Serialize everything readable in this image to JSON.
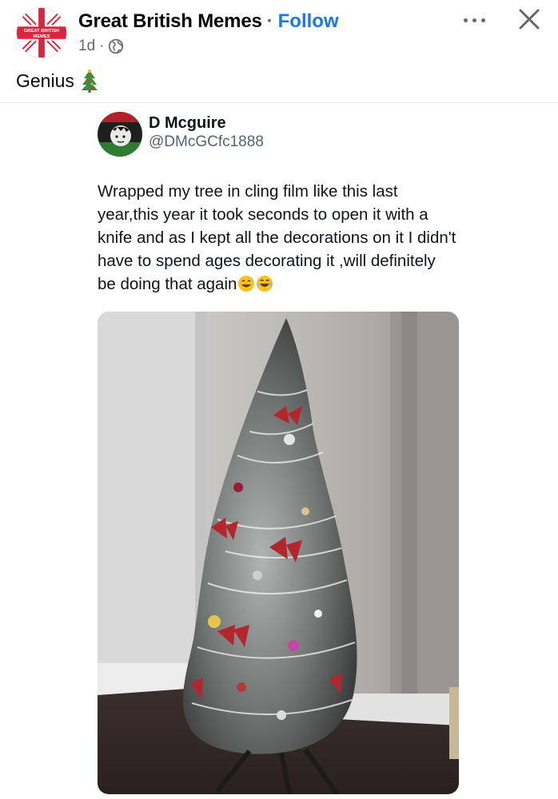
{
  "post": {
    "page_name": "Great British Memes",
    "separator": "·",
    "follow_label": "Follow",
    "time_ago": "1d",
    "meta_separator": "·",
    "caption": "Genius",
    "avatar_text_line1": "GREAT BRITISH",
    "avatar_text_line2": "MEMES"
  },
  "icons": {
    "page_avatar": "union-jack-logo",
    "privacy": "globe-icon",
    "more": "more-horizontal-icon",
    "close": "close-icon",
    "caption_emoji": "christmas-tree-emoji"
  },
  "tweet": {
    "display_name": "D Mcguire",
    "handle": "@DMcGCfc1888",
    "text": "Wrapped my tree in cling film like this last year,this year it took seconds to open it with a knife and as I kept all the decorations on it I didn't have to spend ages decorating it ,will definitely be doing that again",
    "emojis": [
      "grinning-sweat-emoji",
      "tears-of-joy-emoji"
    ],
    "photo": "christmas-tree-wrapped-in-cling-film"
  },
  "colors": {
    "follow_blue": "#1877f2",
    "secondary_text": "#65676b",
    "union_jack_red": "#d7263d"
  }
}
